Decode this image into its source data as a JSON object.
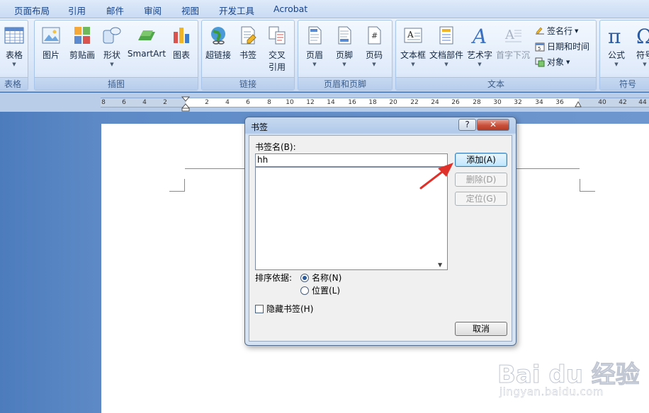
{
  "tabs": [
    "页面布局",
    "引用",
    "邮件",
    "审阅",
    "视图",
    "开发工具",
    "Acrobat"
  ],
  "ribbon": {
    "groups": {
      "table": "表格",
      "illustrations": "插图",
      "links": "链接",
      "header_footer": "页眉和页脚",
      "text": "文本",
      "symbols": "符号"
    },
    "buttons": {
      "table": "表格",
      "picture": "图片",
      "clipart": "剪贴画",
      "shapes": "形状",
      "smartart": "SmartArt",
      "chart": "图表",
      "hyperlink": "超链接",
      "bookmark": "书签",
      "crossref_1": "交叉",
      "crossref_2": "引用",
      "header": "页眉",
      "footer": "页脚",
      "page_number": "页码",
      "textbox": "文本框",
      "quick_parts": "文档部件",
      "wordart": "艺术字",
      "dropcap": "首字下沉",
      "signature_line": "签名行",
      "date_time": "日期和时间",
      "object": "对象",
      "equation": "公式",
      "symbol": "符号"
    }
  },
  "ruler": {
    "labels": [
      "8",
      "6",
      "4",
      "2",
      "2",
      "4",
      "6",
      "8",
      "10",
      "12",
      "14",
      "16",
      "18",
      "20",
      "22",
      "24",
      "26",
      "28",
      "30",
      "32",
      "34",
      "36",
      "40",
      "42",
      "44"
    ]
  },
  "dialog": {
    "title": "书签",
    "help": "?",
    "close": "✕",
    "name_label": "书签名(B):",
    "name_value": "hh",
    "add": "添加(A)",
    "delete": "删除(D)",
    "goto": "定位(G)",
    "sort_label": "排序依据:",
    "sort_name": "名称(N)",
    "sort_location": "位置(L)",
    "hidden": "隐藏书签(H)",
    "cancel": "取消"
  },
  "watermark": {
    "logo": "Bai du 经验",
    "url": "jingyan.baidu.com"
  }
}
